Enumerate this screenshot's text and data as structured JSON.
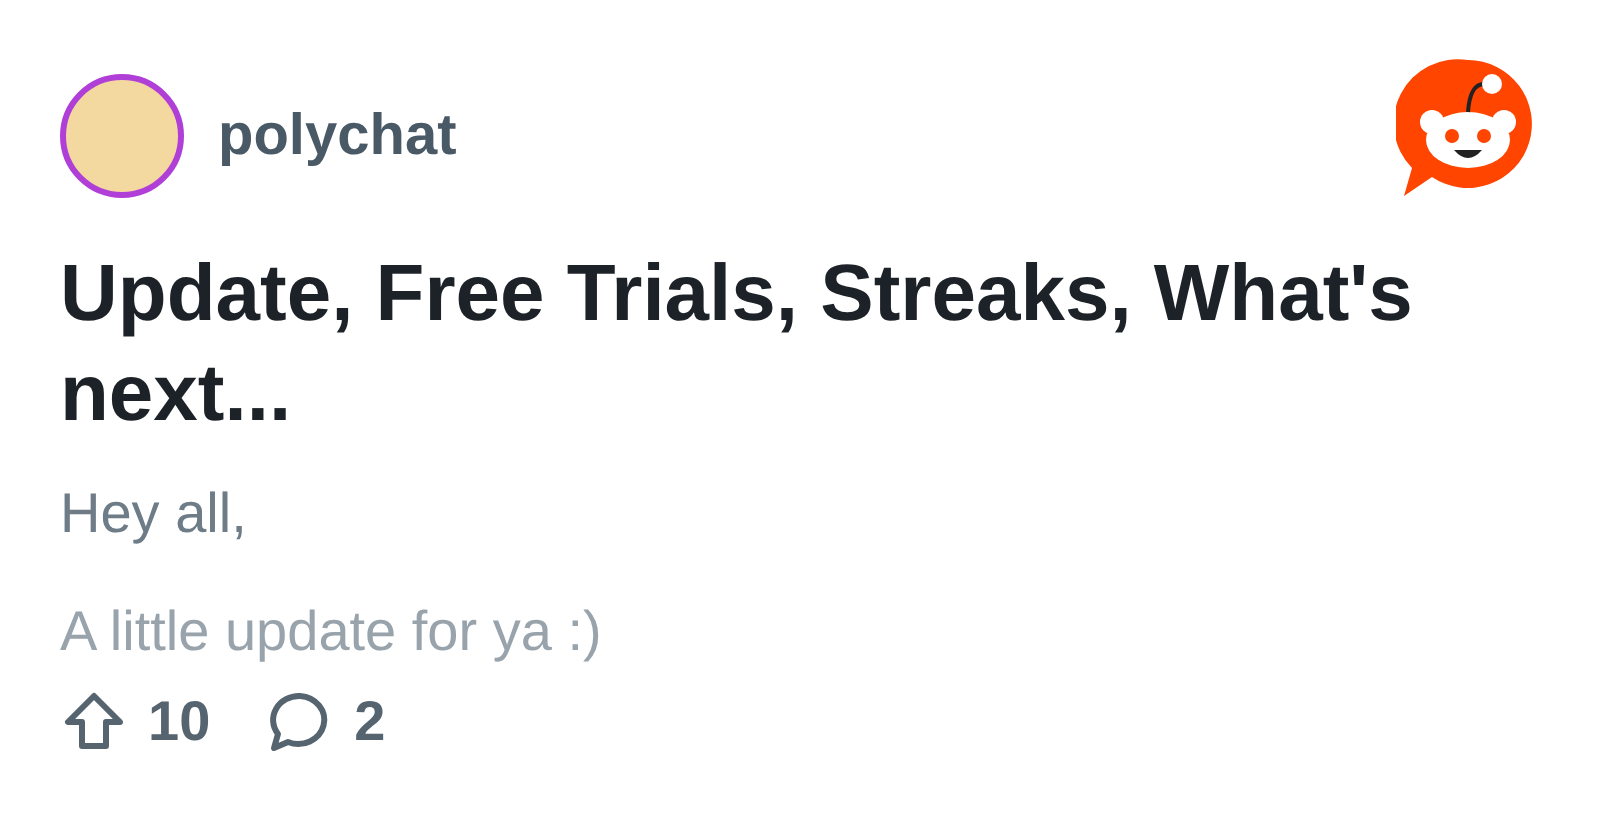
{
  "post": {
    "author": "polychat",
    "title": "Update, Free Trials, Streaks, What's next...",
    "body": [
      "Hey all,",
      "A little update for ya :)"
    ]
  },
  "actions": {
    "upvotes": "10",
    "comments": "2"
  }
}
